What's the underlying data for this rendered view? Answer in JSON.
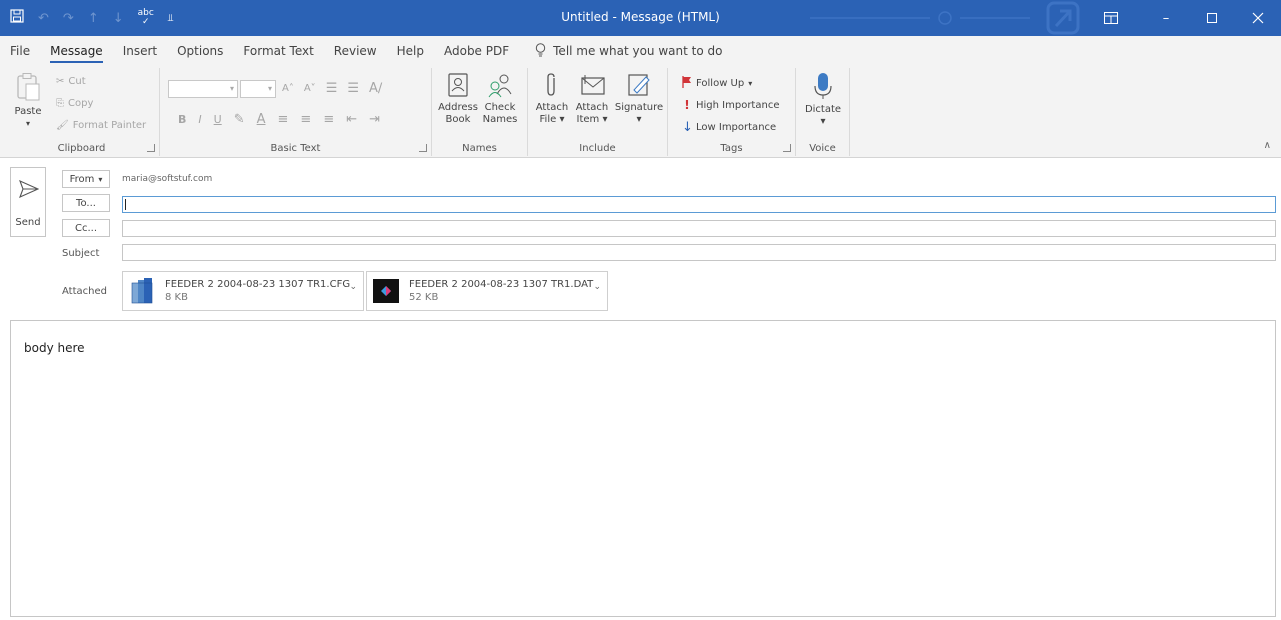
{
  "window": {
    "title": "Untitled  -  Message (HTML)",
    "controls": [
      "ribbon-display-options",
      "minimize",
      "maximize",
      "close"
    ]
  },
  "quick_access": {
    "save_icon": "save-icon",
    "undo_icon": "undo-icon",
    "redo_icon": "redo-icon",
    "up_icon": "arrow-up-icon",
    "down_icon": "arrow-down-icon",
    "spelling_icon": "spelling-icon",
    "customize_icon": "customize-icon"
  },
  "tabs": [
    "File",
    "Message",
    "Insert",
    "Options",
    "Format Text",
    "Review",
    "Help",
    "Adobe PDF"
  ],
  "active_tab": "Message",
  "tell_me": "Tell me what you want to do",
  "ribbon": {
    "clipboard": {
      "label": "Clipboard",
      "paste": "Paste",
      "cut": "Cut",
      "copy": "Copy",
      "format_painter": "Format Painter"
    },
    "basic_text": {
      "label": "Basic Text"
    },
    "names": {
      "label": "Names",
      "address_book_1": "Address",
      "address_book_2": "Book",
      "check_names_1": "Check",
      "check_names_2": "Names"
    },
    "include": {
      "label": "Include",
      "attach_file_1": "Attach",
      "attach_file_2": "File",
      "attach_item_1": "Attach",
      "attach_item_2": "Item",
      "signature": "Signature"
    },
    "tags": {
      "label": "Tags",
      "follow_up": "Follow Up",
      "high_importance": "High Importance",
      "low_importance": "Low Importance"
    },
    "voice": {
      "label": "Voice",
      "dictate": "Dictate"
    }
  },
  "compose": {
    "send": "Send",
    "from_button": "From",
    "from_value": "maria@softstuf.com",
    "to_button": "To...",
    "cc_button": "Cc...",
    "subject_label": "Subject",
    "attached_label": "Attached",
    "attachments": [
      {
        "name": "FEEDER 2 2004-08-23 1307 TR1.CFG",
        "size": "8 KB",
        "icon": "cfg-file-icon"
      },
      {
        "name": "FEEDER 2 2004-08-23 1307 TR1.DAT",
        "size": "52 KB",
        "icon": "dat-file-icon"
      }
    ],
    "body": "body here"
  },
  "colors": {
    "titlebar": "#2b62b5",
    "ribbon_bg": "#f3f3f3",
    "accent": "#2b62b5",
    "flag_red": "#d13438",
    "low_importance_blue": "#2b62b5"
  }
}
